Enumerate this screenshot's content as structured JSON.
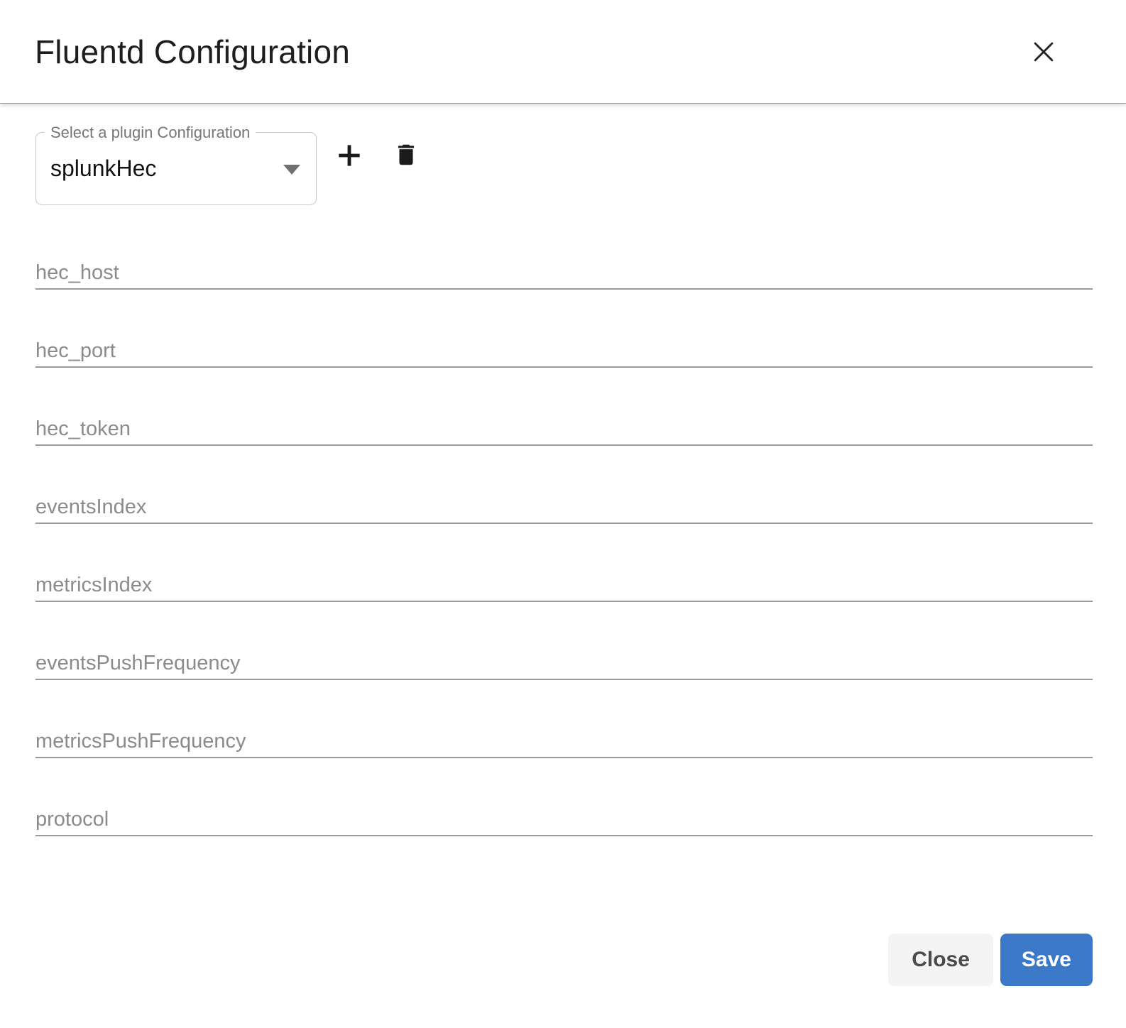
{
  "dialog": {
    "title": "Fluentd Configuration"
  },
  "plugin_selector": {
    "label": "Select a plugin Configuration",
    "selected_value": "splunkHec"
  },
  "icons": {
    "close": "x-icon",
    "dropdown": "chevron-down-icon",
    "add": "plus-icon",
    "delete": "trash-icon"
  },
  "fields": [
    {
      "placeholder": "hec_host",
      "value": ""
    },
    {
      "placeholder": "hec_port",
      "value": ""
    },
    {
      "placeholder": "hec_token",
      "value": ""
    },
    {
      "placeholder": "eventsIndex",
      "value": ""
    },
    {
      "placeholder": "metricsIndex",
      "value": ""
    },
    {
      "placeholder": "eventsPushFrequency",
      "value": ""
    },
    {
      "placeholder": "metricsPushFrequency",
      "value": ""
    },
    {
      "placeholder": "protocol",
      "value": ""
    }
  ],
  "footer": {
    "close_label": "Close",
    "save_label": "Save"
  },
  "colors": {
    "save_button": "#3b78c8",
    "close_button_bg": "#f4f4f4",
    "close_button_text": "#4b4b4b",
    "placeholder_text": "#8b8b8b",
    "underline": "#9a9a9a",
    "title_text": "#1e1e1e",
    "label_text": "#767676",
    "select_border": "#c9c9c9",
    "icon_color": "#1b1b1b"
  }
}
